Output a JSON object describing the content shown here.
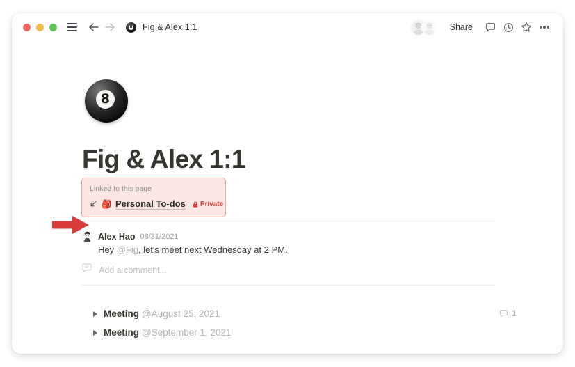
{
  "window": {
    "titlebar": {
      "traffic_lights": [
        "close",
        "minimize",
        "zoom"
      ],
      "menu_icon": "hamburger-icon",
      "back_icon": "arrow-left-icon",
      "forward_icon": "arrow-right-icon",
      "favicon_label": "8",
      "tab_title": "Fig & Alex 1:1",
      "share_label": "Share",
      "comment_icon": "comment-icon",
      "history_icon": "clock-icon",
      "favorite_icon": "star-icon",
      "more_icon": "more-dots-icon"
    }
  },
  "page": {
    "icon_label": "8",
    "title": "Fig & Alex 1:1"
  },
  "linked_callout": {
    "label": "Linked to this page",
    "link_arrow_icon": "arrow-down-left-icon",
    "page_emoji": "🎒",
    "page_name": "Personal To-dos",
    "lock_icon": "lock-icon",
    "privacy_label": "Private",
    "background_color": "#fbe6e4",
    "border_color": "#f0a7a0",
    "accent_color": "#e03e3e"
  },
  "annotation": {
    "arrow_color": "#d93c3c",
    "arrow_outline_color": "#ffffff",
    "direction": "right"
  },
  "comment": {
    "avatar": "user-photo-avatar",
    "author": "Alex Hao",
    "date": "08/31/2021",
    "text_prefix": "Hey ",
    "mention": "@Fig",
    "text_suffix": ", let's meet next Wednesday at 2 PM."
  },
  "add_comment": {
    "icon": "comment-outline-icon",
    "placeholder": "Add a comment..."
  },
  "toggles": [
    {
      "caret": "caret-right-icon",
      "label": "Meeting",
      "mention": "@August 25, 2021",
      "comment_icon": "comment-icon",
      "comment_count": "1"
    },
    {
      "caret": "caret-right-icon",
      "label": "Meeting",
      "mention": "@September 1, 2021",
      "comment_icon": "",
      "comment_count": ""
    }
  ]
}
